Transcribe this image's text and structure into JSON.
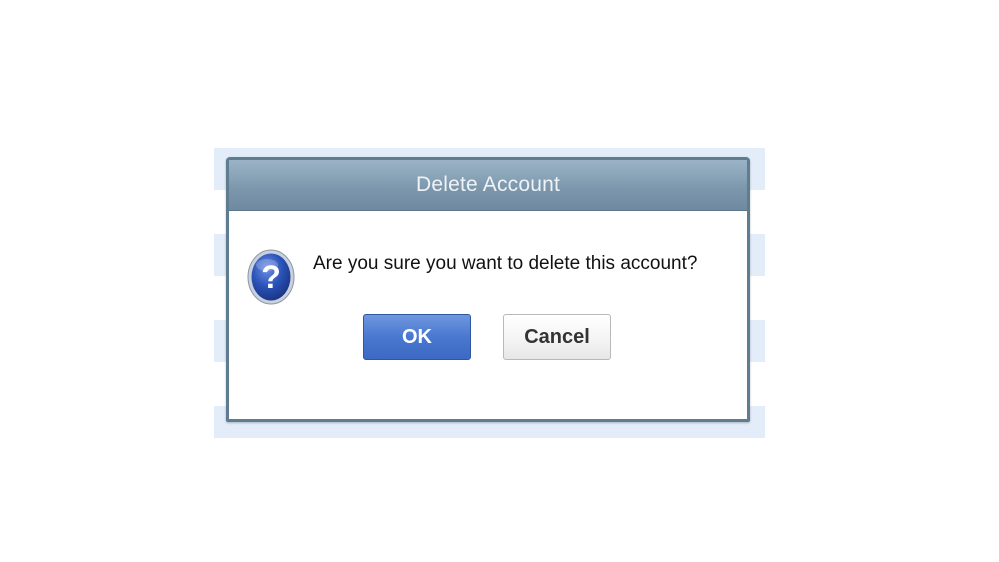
{
  "dialog": {
    "title": "Delete Account",
    "message": "Are you sure you want to delete this account?",
    "icon": "question-icon",
    "ok_label": "OK",
    "cancel_label": "Cancel"
  },
  "colors": {
    "titlebar": "#7d98ad",
    "ok_button": "#4a78d0",
    "backdrop_stripe": "#e3edf9",
    "icon_blue": "#2a52b8"
  }
}
